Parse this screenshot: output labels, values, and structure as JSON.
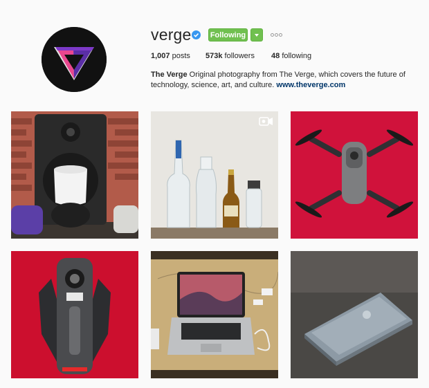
{
  "profile": {
    "username": "verge",
    "follow_label": "Following",
    "verified": true
  },
  "stats": {
    "posts_count": "1,007",
    "posts_label": "posts",
    "followers_count": "573k",
    "followers_label": "followers",
    "following_count": "48",
    "following_label": "following"
  },
  "bio": {
    "name": "The Verge",
    "text": "Original photography from The Verge, which covers the future of technology, science, art, and culture.",
    "link": "www.theverge.com"
  },
  "colors": {
    "follow_button": "#70c050",
    "link": "#003569",
    "verified_badge": "#3897f0"
  },
  "posts": [
    {
      "subject": "smart speaker and studio monitor",
      "video": false
    },
    {
      "subject": "glass bottles on table",
      "video": true
    },
    {
      "subject": "drone on red background",
      "video": false
    },
    {
      "subject": "folded drone on red background",
      "video": false
    },
    {
      "subject": "laptop with accessories on map",
      "video": false
    },
    {
      "subject": "closed laptop on table",
      "video": false
    }
  ]
}
